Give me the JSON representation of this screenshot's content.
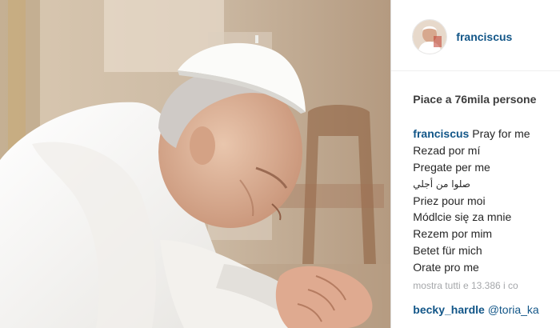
{
  "post": {
    "author": {
      "username": "franciscus",
      "avatar_icon": "avatar-pope-icon"
    },
    "photo": {
      "icon": "pope-praying-photo"
    },
    "likes_text": "Piace a 76mila persone",
    "caption": {
      "username": "franciscus",
      "lines": [
        "Pray for me",
        "Rezad por mí",
        "Pregate per me",
        "صلوا من أجلي",
        "Priez pour moi",
        "Módlcie się za mnie",
        "Rezem por mim",
        "Betet für mich",
        "Orate pro me"
      ]
    },
    "comments": {
      "show_all_text": "mostra tutti e 13.386 i co",
      "first": {
        "username": "becky_hardle",
        "mention": "@toria_ka"
      }
    }
  },
  "colors": {
    "link_blue": "#125688",
    "muted_gray": "#a5a7aa",
    "text_dark": "#262626"
  }
}
